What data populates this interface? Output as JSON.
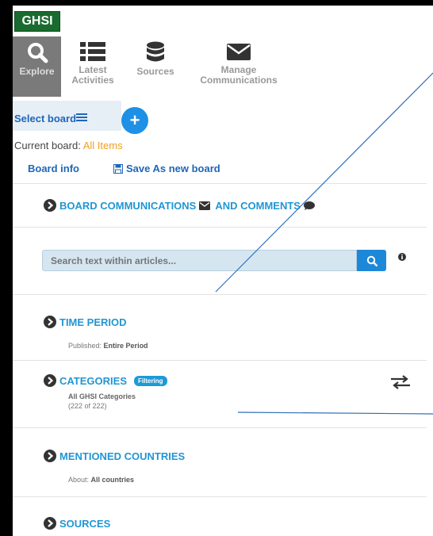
{
  "logo": {
    "text": "GHSI"
  },
  "nav": {
    "items": [
      {
        "label": "Explore",
        "icon": "search-icon"
      },
      {
        "label": "Latest\nActivities",
        "icon": "list-icon"
      },
      {
        "label": "Sources",
        "icon": "database-icon"
      },
      {
        "label": "Manage\nCommunications",
        "icon": "envelope-icon"
      }
    ]
  },
  "board": {
    "select_label": "Select board",
    "current_label": "Current board:",
    "current_value": "All Items",
    "info_label": "Board info",
    "save_label": "Save As new board"
  },
  "sections": {
    "communications": {
      "title_a": "BOARD COMMUNICATIONS",
      "title_b": "AND COMMENTS"
    },
    "search": {
      "placeholder": "Search text within articles..."
    },
    "time_period": {
      "title": "TIME PERIOD",
      "sub_label": "Published:",
      "sub_value": "Entire Period"
    },
    "categories": {
      "title": "CATEGORIES",
      "badge": "Filtering",
      "sub_value": "All GHSI Categories",
      "count": "(222 of 222)"
    },
    "countries": {
      "title": "MENTIONED COUNTRIES",
      "sub_label": "About:",
      "sub_value": "All countries"
    },
    "sources": {
      "title": "SOURCES"
    }
  },
  "colors": {
    "accent": "#2196d3",
    "link": "#1f66b8",
    "highlight": "#f0a020",
    "logo_bg": "#1a6b2f"
  }
}
